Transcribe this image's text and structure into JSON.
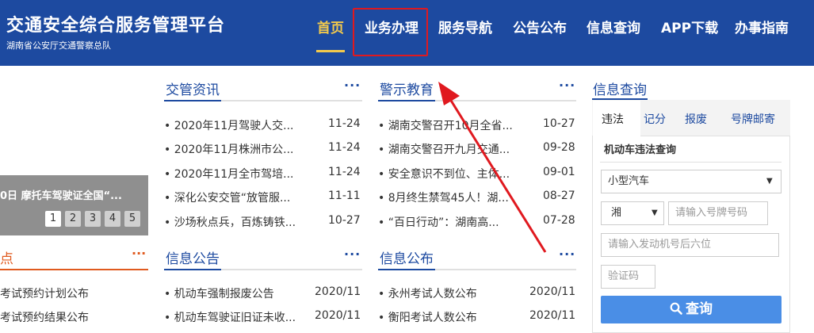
{
  "header": {
    "title": "交通安全综合服务管理平台",
    "subtitle": "湖南省公安厅交通警察总队",
    "nav": [
      "首页",
      "业务办理",
      "服务导航",
      "公告公布",
      "信息查询",
      "APP下载",
      "办事指南"
    ],
    "active_index": 0
  },
  "banner": {
    "caption": "0日 摩托车驾驶证全国“...",
    "pages": [
      "1",
      "2",
      "3",
      "4",
      "5"
    ],
    "active_page": "1"
  },
  "left_section": {
    "title": "点",
    "more": "···",
    "items": [
      "考试预约计划公布",
      "考试预约结果公布"
    ]
  },
  "news": {
    "title": "交管资讯",
    "more": "···",
    "items": [
      {
        "text": "• 2020年11月驾驶人交...",
        "date": "11-24"
      },
      {
        "text": "• 2020年11月株洲市公...",
        "date": "11-24"
      },
      {
        "text": "• 2020年11月全市驾培...",
        "date": "11-24"
      },
      {
        "text": "• 深化公安交管“放管服...",
        "date": "11-11"
      },
      {
        "text": "• 沙场秋点兵，百炼铸铁...",
        "date": "10-27"
      }
    ]
  },
  "warning": {
    "title": "警示教育",
    "more": "···",
    "items": [
      {
        "text": "• 湖南交警召开10月全省...",
        "date": "10-27"
      },
      {
        "text": "• 湖南交警召开九月交通...",
        "date": "09-28"
      },
      {
        "text": "• 安全意识不到位、主体...",
        "date": "09-01"
      },
      {
        "text": "• 8月终生禁驾45人！湖...",
        "date": "08-27"
      },
      {
        "text": "• “百日行动”：湖南高...",
        "date": "07-28"
      }
    ]
  },
  "notice": {
    "title": "信息公告",
    "more": "···",
    "items": [
      {
        "text": "• 机动车强制报废公告",
        "date": "2020/11"
      },
      {
        "text": "• 机动车驾驶证旧证未收...",
        "date": "2020/11"
      }
    ]
  },
  "publish": {
    "title": "信息公布",
    "more": "···",
    "items": [
      {
        "text": "• 永州考试人数公布",
        "date": "2020/11"
      },
      {
        "text": "• 衡阳考试人数公布",
        "date": "2020/11"
      }
    ]
  },
  "query": {
    "title": "信息查询",
    "tabs": [
      "违法",
      "记分",
      "报废",
      "号牌邮寄"
    ],
    "active_tab": "违法",
    "form_title": "机动车违法查询",
    "vehicle_type": "小型汽车",
    "province": "湘",
    "plate_placeholder": "请输入号牌号码",
    "engine_placeholder": "请输入发动机号后六位",
    "captcha_placeholder": "验证码",
    "submit_label": "查询",
    "submit_icon": "search-icon"
  },
  "colors": {
    "header_bg": "#1d4aa0",
    "nav_active": "#f2c94c",
    "highlight_box": "#e0191f",
    "arrow": "#e0191f",
    "button": "#4a8ee6"
  }
}
